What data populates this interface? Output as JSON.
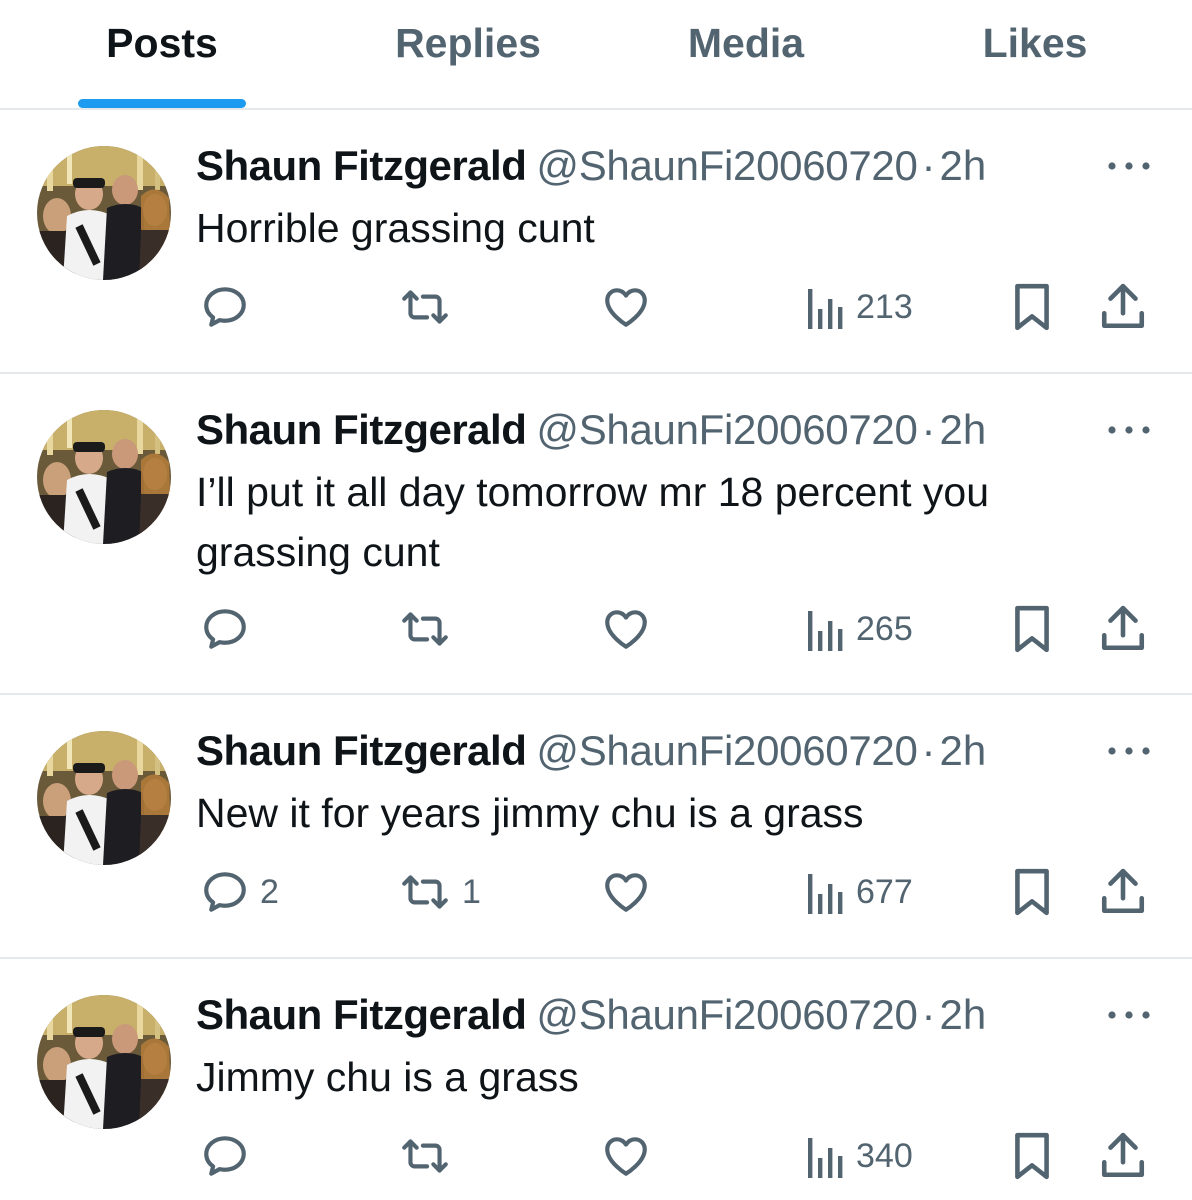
{
  "tabs": [
    {
      "label": "Posts",
      "active": true
    },
    {
      "label": "Replies",
      "active": false
    },
    {
      "label": "Media",
      "active": false
    },
    {
      "label": "Likes",
      "active": false
    }
  ],
  "colors": {
    "accent": "#1d9bf0",
    "text_primary": "#0f1419",
    "text_secondary": "#536471",
    "divider": "#e6e9ec"
  },
  "icons": {
    "reply": "speech-bubble-icon",
    "repost": "retweet-arrows-icon",
    "like": "heart-icon",
    "views": "bar-chart-icon",
    "bookmark": "bookmark-icon",
    "share": "share-upload-icon",
    "more": "ellipsis-icon"
  },
  "tweets": [
    {
      "name": "Shaun Fitzgerald",
      "handle": "@ShaunFi20060720",
      "separator": "·",
      "time": "2h",
      "text": "Horrible grassing cunt",
      "replies": "",
      "reposts": "",
      "likes": "",
      "views": "213"
    },
    {
      "name": "Shaun Fitzgerald",
      "handle": "@ShaunFi20060720",
      "separator": "·",
      "time": "2h",
      "text": "I’ll put it all day tomorrow mr 18 percent you grassing cunt",
      "replies": "",
      "reposts": "",
      "likes": "",
      "views": "265"
    },
    {
      "name": "Shaun Fitzgerald",
      "handle": "@ShaunFi20060720",
      "separator": "·",
      "time": "2h",
      "text": "New it for years jimmy chu is a grass",
      "replies": "2",
      "reposts": "1",
      "likes": "",
      "views": "677"
    },
    {
      "name": "Shaun Fitzgerald",
      "handle": "@ShaunFi20060720",
      "separator": "·",
      "time": "2h",
      "text": "Jimmy chu is a grass",
      "replies": "",
      "reposts": "",
      "likes": "",
      "views": "340"
    }
  ]
}
